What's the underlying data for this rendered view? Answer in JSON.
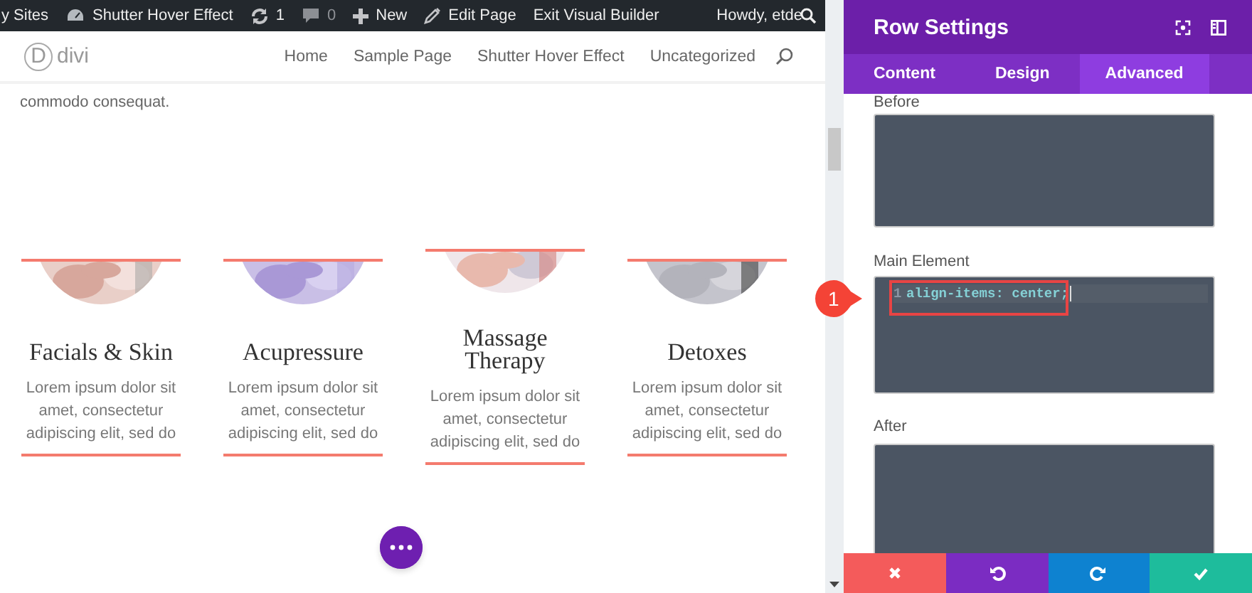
{
  "admin_bar": {
    "items": [
      {
        "kind": "text",
        "label": "y Sites"
      },
      {
        "kind": "gauge",
        "label": "Shutter Hover Effect"
      },
      {
        "kind": "updates",
        "label": "1"
      },
      {
        "kind": "comments",
        "label": "0"
      },
      {
        "kind": "new",
        "label": "New"
      },
      {
        "kind": "edit",
        "label": "Edit Page"
      },
      {
        "kind": "text",
        "label": "Exit Visual Builder"
      }
    ],
    "greeting": "Howdy, etde"
  },
  "header": {
    "logo_letter": "D",
    "logo_text": "divi",
    "nav": [
      "Home",
      "Sample Page",
      "Shutter Hover Effect",
      "Uncategorized"
    ]
  },
  "intro": "commodo consequat.",
  "cards": [
    {
      "title": "Facials & Skin",
      "text": "Lorem ipsum dolor sit amet, consectetur adipiscing elit, sed do"
    },
    {
      "title": "Acupressure",
      "text": "Lorem ipsum dolor sit amet, consectetur adipiscing elit, sed do"
    },
    {
      "title": "Massage Therapy",
      "text": "Lorem ipsum dolor sit amet, consectetur adipiscing elit, sed do"
    },
    {
      "title": "Detoxes",
      "text": "Lorem ipsum dolor sit amet, consectetur adipiscing elit, sed do"
    }
  ],
  "panel": {
    "title": "Row Settings",
    "tabs": [
      {
        "label": "Content",
        "selected": false
      },
      {
        "label": "Design",
        "selected": false
      },
      {
        "label": "Advanced",
        "selected": true
      }
    ],
    "fields": [
      {
        "label": "Before"
      },
      {
        "label": "Main Element",
        "code": [
          {
            "number": "1",
            "text": "align-items: center;"
          }
        ],
        "callout": "1"
      },
      {
        "label": "After"
      }
    ],
    "footer": [
      {
        "kind": "cancel"
      },
      {
        "kind": "undo"
      },
      {
        "kind": "redo"
      },
      {
        "kind": "save"
      }
    ]
  }
}
